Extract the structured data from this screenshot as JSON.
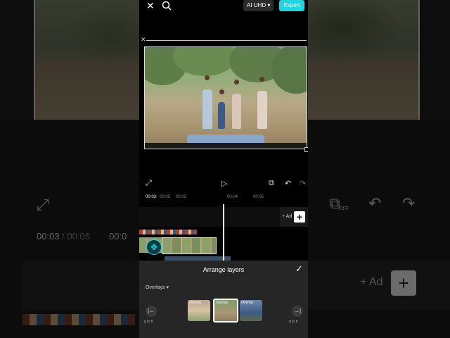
{
  "topbar": {
    "close_glyph": "✕",
    "quality_label": "AI UHD",
    "quality_caret": "▾",
    "export_label": "Export"
  },
  "preview": {
    "selection_close_glyph": "✕"
  },
  "controls": {
    "fullscreen_glyph": "⤢",
    "play_glyph": "▷",
    "pip_glyph": "⧉",
    "undo_glyph": "↶",
    "redo_glyph": "↷"
  },
  "timeline": {
    "current_time": "00:03",
    "total_time": "00:05",
    "ticks": [
      "00:02",
      "00:04",
      "00:05"
    ],
    "add_label": "+ Ad",
    "add_button_glyph": "+"
  },
  "background": {
    "current_time": "00:03",
    "total_time": "00:05",
    "time2": "00:0",
    "add_label": "+ Ad",
    "plus_glyph": "+",
    "off_label": "OFF"
  },
  "arrange_sheet": {
    "title": "Arrange layers",
    "confirm_glyph": "✓",
    "overlays_label": "Overlays",
    "overlays_caret": "▾",
    "thumbs": [
      {
        "label": "Overlay"
      },
      {
        "label": "Overlay"
      },
      {
        "label": "Overlay"
      }
    ],
    "to_front_label": "g to fr",
    "to_back_label": "d to b",
    "left_btn_glyph": "|←",
    "right_btn_glyph": "→|"
  },
  "colors": {
    "accent": "#22d3e0",
    "sheet_bg": "#262626"
  }
}
